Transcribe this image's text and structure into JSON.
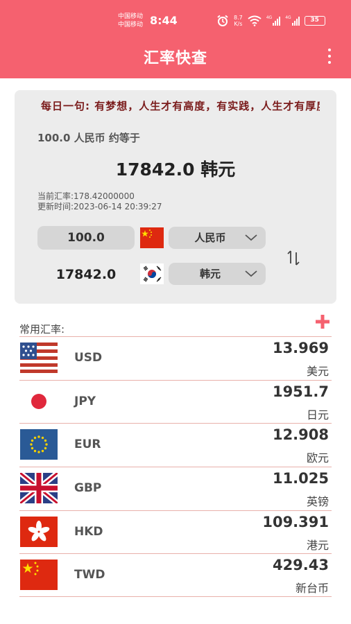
{
  "status": {
    "carrier1": "中国移动",
    "carrier2": "中国移动",
    "time": "8:44",
    "speed_value": "8.7",
    "speed_unit": "K/s",
    "net_type": "4G",
    "battery": "35"
  },
  "appbar": {
    "title": "汇率快查"
  },
  "converter": {
    "quote": "每日一句:  有梦想，人生才有高度，有实践，人生才有厚度",
    "summary": "100.0 人民币 约等于",
    "result": "17842.0 韩元",
    "rate_line": "当前汇率:178.42000000",
    "updated_line": "更新时间:2023-06-14 20:39:27",
    "from_amount": "100.0",
    "from_currency": "人民币",
    "to_amount": "17842.0",
    "to_currency": "韩元"
  },
  "common": {
    "label": "常用汇率:",
    "rates": [
      {
        "code": "USD",
        "value": "13.969",
        "name": "美元",
        "flag": "us-flag"
      },
      {
        "code": "JPY",
        "value": "1951.7",
        "name": "日元",
        "flag": "jp-flag"
      },
      {
        "code": "EUR",
        "value": "12.908",
        "name": "欧元",
        "flag": "eu-flag"
      },
      {
        "code": "GBP",
        "value": "11.025",
        "name": "英镑",
        "flag": "uk-flag"
      },
      {
        "code": "HKD",
        "value": "109.391",
        "name": "港元",
        "flag": "hk-flag"
      },
      {
        "code": "TWD",
        "value": "429.43",
        "name": "新台币",
        "flag": "tw-flag"
      }
    ]
  },
  "colors": {
    "accent": "#f5616f",
    "card_bg": "#ececec",
    "divider": "#e8b0aa",
    "quote_text": "#7a1b1b"
  }
}
